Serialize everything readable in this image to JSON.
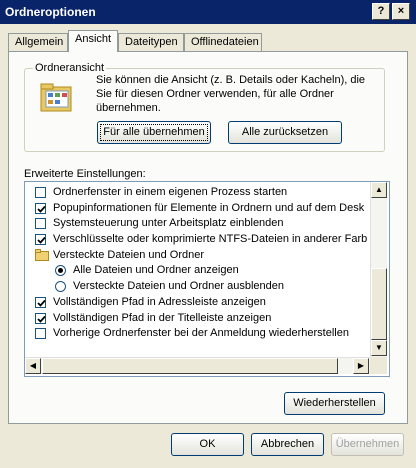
{
  "window": {
    "title": "Ordneroptionen",
    "help_label": "?",
    "close_label": "×"
  },
  "tabs": [
    {
      "label": "Allgemein"
    },
    {
      "label": "Ansicht"
    },
    {
      "label": "Dateitypen"
    },
    {
      "label": "Offlinedateien"
    }
  ],
  "folder_view": {
    "title": "Ordneransicht",
    "description": "Sie können die Ansicht (z. B. Details oder Kacheln), die Sie für diesen Ordner verwenden, für alle Ordner übernehmen.",
    "apply_all_label": "Für alle übernehmen",
    "reset_all_label": "Alle zurücksetzen"
  },
  "advanced": {
    "label": "Erweiterte Einstellungen:",
    "items": [
      {
        "type": "checkbox",
        "checked": false,
        "indent": 0,
        "text": "Ordnerfenster in einem eigenen Prozess starten"
      },
      {
        "type": "checkbox",
        "checked": true,
        "indent": 0,
        "text": "Popupinformationen für Elemente in Ordnern und auf dem Desk"
      },
      {
        "type": "checkbox",
        "checked": false,
        "indent": 0,
        "text": "Systemsteuerung unter Arbeitsplatz einblenden"
      },
      {
        "type": "checkbox",
        "checked": true,
        "indent": 0,
        "text": "Verschlüsselte oder komprimierte NTFS-Dateien in anderer Farb"
      },
      {
        "type": "folder",
        "checked": false,
        "indent": 0,
        "text": "Versteckte Dateien und Ordner"
      },
      {
        "type": "radio",
        "checked": true,
        "indent": 1,
        "text": "Alle Dateien und Ordner anzeigen"
      },
      {
        "type": "radio",
        "checked": false,
        "indent": 1,
        "text": "Versteckte Dateien und Ordner ausblenden"
      },
      {
        "type": "checkbox",
        "checked": true,
        "indent": 0,
        "text": "Vollständigen Pfad in Adressleiste anzeigen"
      },
      {
        "type": "checkbox",
        "checked": true,
        "indent": 0,
        "text": "Vollständigen Pfad in der Titelleiste anzeigen"
      },
      {
        "type": "checkbox",
        "checked": false,
        "indent": 0,
        "text": "Vorherige Ordnerfenster bei der Anmeldung wiederherstellen"
      }
    ],
    "restore_label": "Wiederherstellen"
  },
  "footer": {
    "ok_label": "OK",
    "cancel_label": "Abbrechen",
    "apply_label": "Übernehmen"
  }
}
